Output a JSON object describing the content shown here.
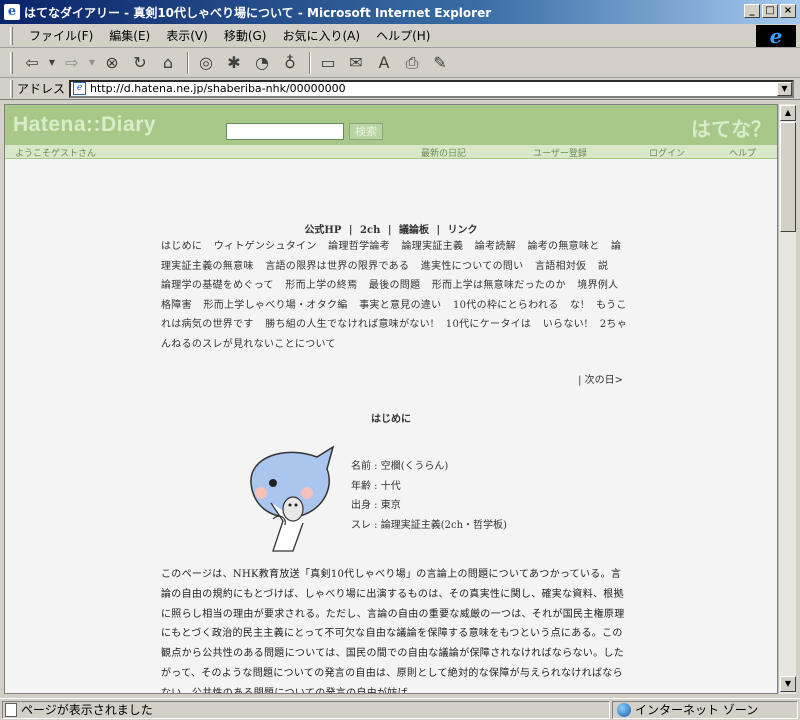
{
  "window": {
    "title": "はてなダイアリー - 真剣10代しゃべり場について - Microsoft Internet Explorer",
    "controls": [
      "_",
      "□",
      "×"
    ]
  },
  "menu": [
    "ファイル(F)",
    "編集(E)",
    "表示(V)",
    "移動(G)",
    "お気に入り(A)",
    "ヘルプ(H)"
  ],
  "address": {
    "label": "アドレス",
    "url": "http://d.hatena.ne.jp/shaberiba-nhk/00000000"
  },
  "hatena": {
    "logo": "Hatena::Diary",
    "search_button": "検索",
    "brand": "はてな？",
    "welcome": "ようこそゲストさん",
    "nav": [
      "最新の日記",
      "ユーザー登録",
      "ログイン",
      "ヘルプ"
    ]
  },
  "page_links": [
    "公式HP",
    "2ch",
    "議論板",
    "リンク"
  ],
  "topics": [
    "はじめに",
    "ウィトゲンシュタイン",
    "論理哲学論考",
    "論理実証主義",
    "論考読解",
    "論考の無意味と",
    "論理実証主義の無意味",
    "言語の限界は世界の限界である",
    "進実性についての問い",
    "言語相対仮",
    "説",
    "論理学の基礎をめぐって",
    "形而上学の終焉",
    "最後の問題",
    "形而上学は無意味だったのか",
    "境界例人格障害",
    "形而上学しゃべり場・オタク編",
    "事実と意見の違い",
    "10代の枠にとらわれる",
    "な!",
    "もうこれは病気の世界です",
    "勝ち組の人生でなければ意味がない!",
    "10代にケータイは",
    "いらない!",
    "2ちゃんねるのスレが見れないことについて"
  ],
  "next_day": "| 次の日>",
  "section_title": "はじめに",
  "profile": {
    "name": "名前 : 空欄(くうらん)",
    "age": "年齢 : 十代",
    "origin": "出身 : 東京",
    "thread": "スレ : 論理実証主義(2ch・哲学板)"
  },
  "body_text": "このページは、NHK教育放送「真剣10代しゃべり場」の言論上の問題についてあつかっている。言論の自由の規約にもとづけば、しゃべり場に出演するものは、その真実性に関し、確実な資料、根拠に照らし相当の理由が要求される。ただし、言論の自由の重要な威厳の一つは、それが国民主権原理にもとづく政治的民主主義にとって不可欠な自由な議論を保障する意味をもつという点にある。この観点から公共性のある問題については、国民の間での自由な議論が保障されなければならない。したがって、そのような問題についての発言の自由は、原則として絶対的な保障が与えられなければならない。公共性のある問題についての発言の自由が妨げ",
  "status": {
    "message": "ページが表示されました",
    "zone": "インターネット ゾーン"
  }
}
